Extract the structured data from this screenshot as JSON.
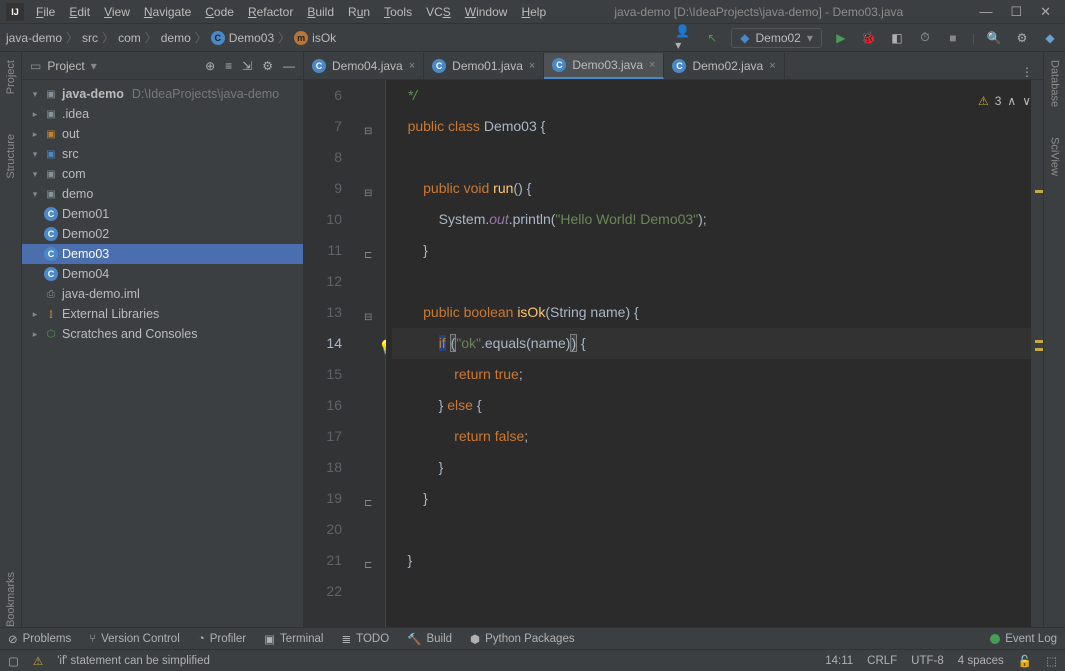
{
  "title": "java-demo [D:\\IdeaProjects\\java-demo] - Demo03.java",
  "menu": {
    "file": "File",
    "edit": "Edit",
    "view": "View",
    "navigate": "Navigate",
    "code": "Code",
    "refactor": "Refactor",
    "build": "Build",
    "run": "Run",
    "tools": "Tools",
    "vcs": "VCS",
    "window": "Window",
    "help": "Help"
  },
  "breadcrumbs": {
    "p0": "java-demo",
    "p1": "src",
    "p2": "com",
    "p3": "demo",
    "p4": "Demo03",
    "p5": "isOk"
  },
  "runconfig": {
    "name": "Demo02"
  },
  "project": {
    "title": "Project",
    "root_name": "java-demo",
    "root_path": "D:\\IdeaProjects\\java-demo",
    "idea": ".idea",
    "out": "out",
    "src": "src",
    "com": "com",
    "demo": "demo",
    "cls1": "Demo01",
    "cls2": "Demo02",
    "cls3": "Demo03",
    "cls4": "Demo04",
    "iml": "java-demo.iml",
    "ext": "External Libraries",
    "scr": "Scratches and Consoles"
  },
  "tabs": {
    "t1": "Demo04.java",
    "t2": "Demo01.java",
    "t3": "Demo03.java",
    "t4": "Demo02.java"
  },
  "code": {
    "l6": "    */",
    "l7a": "    ",
    "l7b": "public class ",
    "l7c": "Demo03 {",
    "l9a": "        ",
    "l9b": "public void ",
    "l9c": "run",
    "l9d": "() {",
    "l10a": "            System.",
    "l10b": "out",
    "l10c": ".println(",
    "l10d": "\"Hello World! Demo03\"",
    "l10e": ");",
    "l11": "        }",
    "l13a": "        ",
    "l13b": "public boolean ",
    "l13c": "isOk",
    "l13d": "(String name) {",
    "l14a": "            ",
    "l14b": "if",
    "l14c": " ",
    "l14d": "(",
    "l14e": "\"ok\"",
    "l14f": ".equals(name)",
    "l14g": ")",
    "l14h": " {",
    "l15a": "                ",
    "l15b": "return true",
    "l15c": ";",
    "l16a": "            } ",
    "l16b": "else ",
    "l16c": "{",
    "l17a": "                ",
    "l17b": "return false",
    "l17c": ";",
    "l18": "            }",
    "l19": "        }",
    "l21": "    }"
  },
  "gutter": {
    "n6": "6",
    "n7": "7",
    "n8": "8",
    "n9": "9",
    "n10": "10",
    "n11": "11",
    "n12": "12",
    "n13": "13",
    "n14": "14",
    "n15": "15",
    "n16": "16",
    "n17": "17",
    "n18": "18",
    "n19": "19",
    "n20": "20",
    "n21": "21",
    "n22": "22"
  },
  "warnings": {
    "count": "3"
  },
  "sidetabs": {
    "project": "Project",
    "structure": "Structure",
    "bookmarks": "Bookmarks",
    "database": "Database",
    "sciview": "SciView"
  },
  "bottom": {
    "problems": "Problems",
    "vcs": "Version Control",
    "profiler": "Profiler",
    "terminal": "Terminal",
    "todo": "TODO",
    "build": "Build",
    "py": "Python Packages",
    "eventlog": "Event Log"
  },
  "status": {
    "hint": "'if' statement can be simplified",
    "pos": "14:11",
    "sep": "CRLF",
    "enc": "UTF-8",
    "indent": "4 spaces"
  }
}
